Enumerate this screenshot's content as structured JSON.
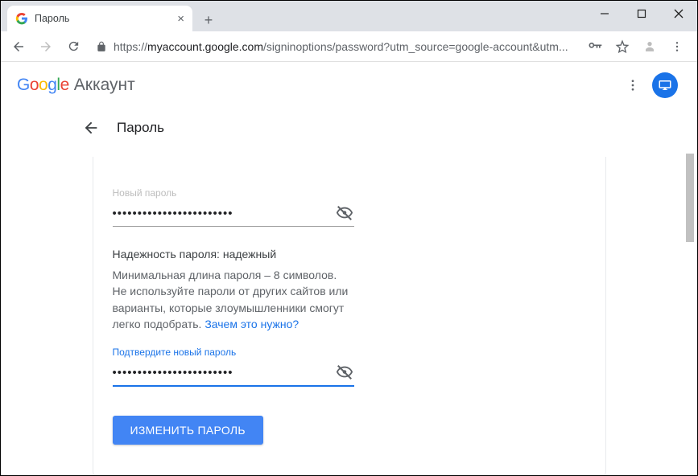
{
  "window": {
    "tab_title": "Пароль"
  },
  "address": {
    "url_scheme": "https://",
    "url_host": "myaccount.google.com",
    "url_path": "/signinoptions/password?utm_source=google-account&utm..."
  },
  "header": {
    "product": "Аккаунт"
  },
  "page": {
    "title": "Пароль"
  },
  "form": {
    "new_password_label": "Новый пароль",
    "new_password_value": "••••••••••••••••••••••••",
    "strength_label": "Надежность пароля:",
    "strength_value": "надежный",
    "hint_text": "Минимальная длина пароля – 8 символов. Не используйте пароли от других сайтов или варианты, которые злоумышленники смогут легко подобрать. ",
    "hint_link": "Зачем это нужно?",
    "confirm_label": "Подтвердите новый пароль",
    "confirm_value": "••••••••••••••••••••••••",
    "submit_label": "ИЗМЕНИТЬ ПАРОЛЬ"
  }
}
